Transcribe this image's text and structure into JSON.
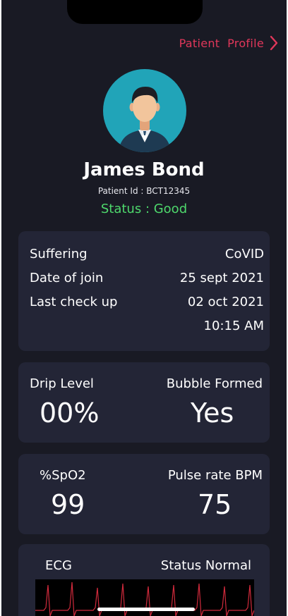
{
  "header": {
    "profile_link_label": "Patient  Profile"
  },
  "patient": {
    "name": "James Bond",
    "patient_id": "Patient Id : BCT12345",
    "status": "Status : Good"
  },
  "info": {
    "rows": [
      {
        "label": "Suffering",
        "value": "CoVID"
      },
      {
        "label": "Date of join",
        "value": "25 sept 2021"
      },
      {
        "label": "Last check up",
        "value": "02 oct 2021"
      }
    ],
    "last_checkup_time": "10:15 AM"
  },
  "drip": {
    "drip_label": "Drip Level",
    "drip_value": "00%",
    "bubble_label": "Bubble Formed",
    "bubble_value": "Yes"
  },
  "vitals": {
    "spo2_label": "%SpO2",
    "spo2_value": "99",
    "pulse_label": "Pulse rate BPM",
    "pulse_value": "75"
  },
  "ecg": {
    "label": "ECG",
    "status": "Status Normal"
  },
  "colors": {
    "background": "#191a24",
    "card": "#232536",
    "accent": "#e0375a",
    "status_good": "#4ed86c",
    "avatar_bg": "#21a4b8"
  },
  "icons": {
    "profile_link": "chevron-right-icon",
    "avatar": "user-avatar-icon"
  }
}
